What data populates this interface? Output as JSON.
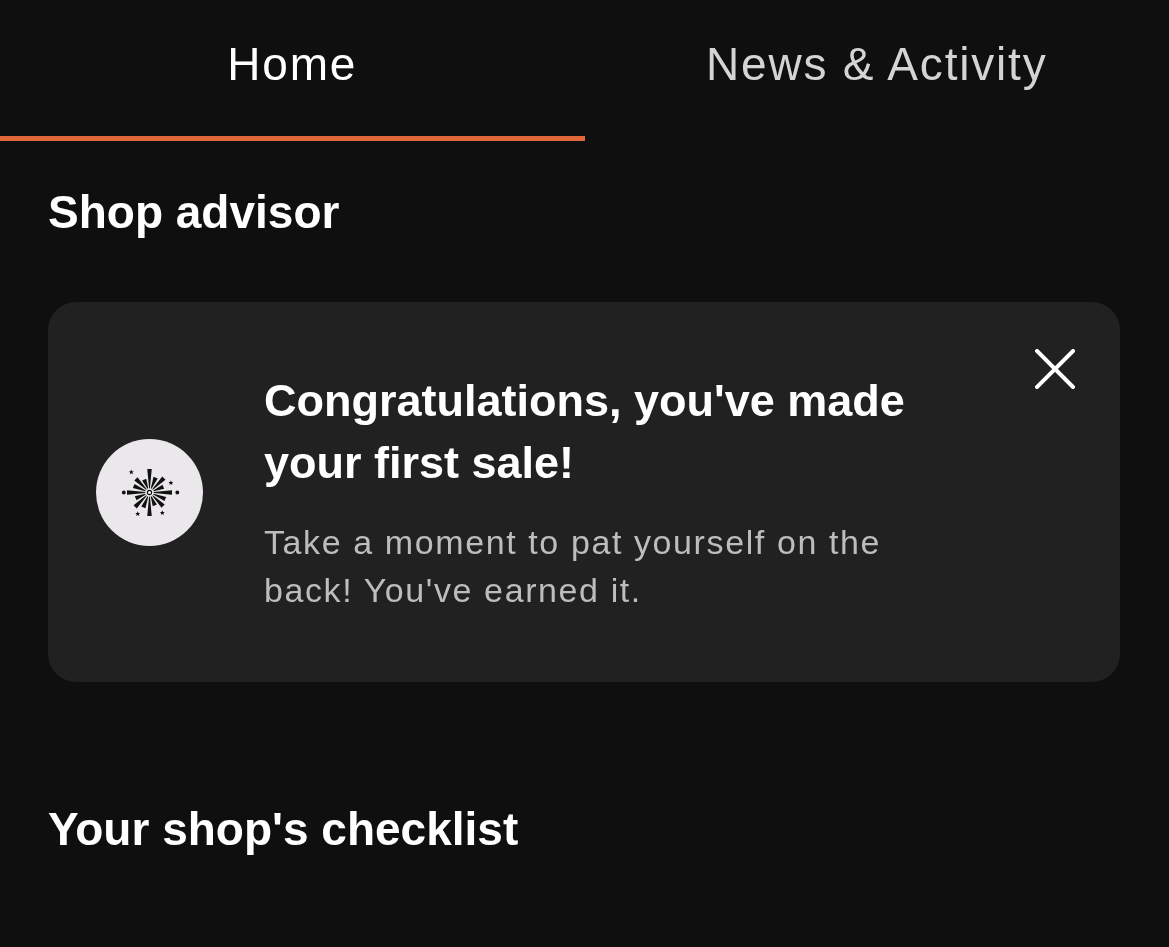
{
  "tabs": [
    {
      "label": "Home",
      "selected": true
    },
    {
      "label": "News & Activity",
      "selected": false
    }
  ],
  "shop_advisor": {
    "heading": "Shop advisor",
    "card": {
      "title": "Congratulations, you've made your first sale!",
      "message": "Take a moment to pat yourself on the back! You've earned it."
    }
  },
  "checklist": {
    "heading": "Your shop's checklist"
  }
}
